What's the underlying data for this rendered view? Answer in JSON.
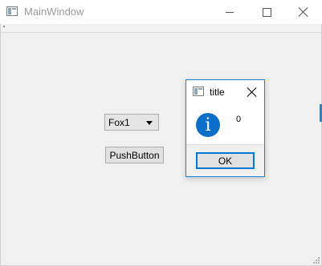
{
  "main_window": {
    "title": "MainWindow"
  },
  "combo_box": {
    "value": "Fox1"
  },
  "push_button": {
    "label": "PushButton"
  },
  "dialog": {
    "title": "title",
    "message": "0",
    "ok_label": "OK",
    "icon": "information-icon",
    "accent_color": "#1883d7"
  }
}
